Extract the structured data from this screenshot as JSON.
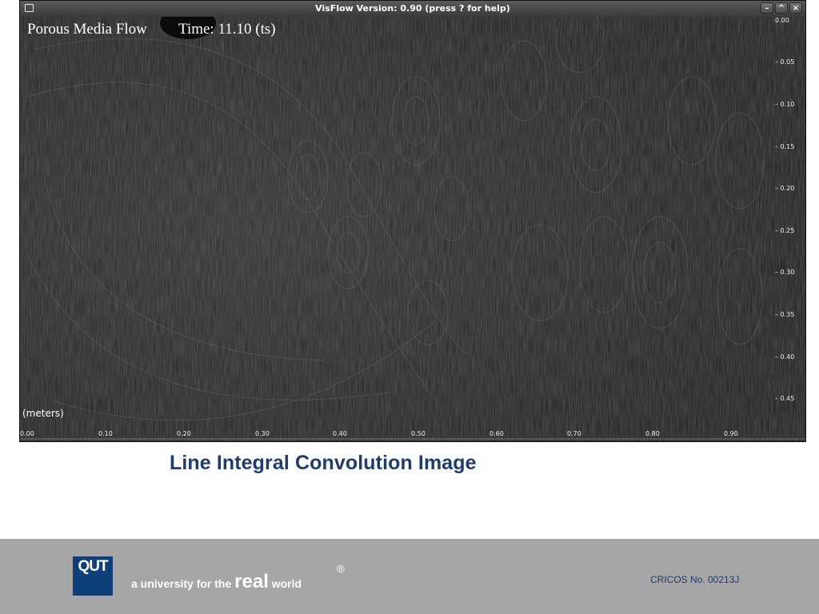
{
  "window": {
    "title": "VisFlow Version: 0.90 (press ? for help)",
    "buttons": [
      "–",
      "^",
      "×"
    ]
  },
  "viewer": {
    "heading": "Porous Media Flow",
    "time": "Time: 11.10 (ts)",
    "units_label": "(meters)",
    "x_axis_ticks": [
      "0.00",
      "0.10",
      "0.20",
      "0.30",
      "0.40",
      "0.50",
      "0.60",
      "0.70",
      "0.80",
      "0.90"
    ],
    "y_axis_ticks": [
      "0.00",
      "– 0.05",
      "– 0.10",
      "– 0.15",
      "– 0.20",
      "– 0.25",
      "– 0.30",
      "– 0.35",
      "– 0.40",
      "– 0.45"
    ]
  },
  "caption": "Line Integral Convolution Image",
  "footer": {
    "logo": "QUT",
    "tagline_prefix": "a university for the",
    "tagline_real": "real",
    "tagline_world": "world",
    "registered": "®",
    "cricos": "CRICOS No. 00213J"
  },
  "colors": {
    "caption": "#1f3c6e",
    "footer_bg": "#a6a6a6",
    "logo_bg": "#0f3f7a"
  }
}
